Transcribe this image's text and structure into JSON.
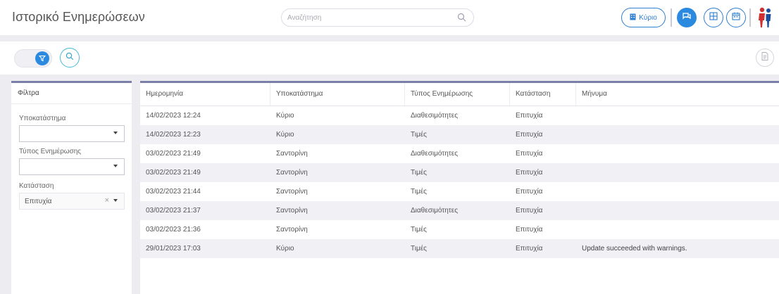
{
  "header": {
    "title": "Ιστορικό Ενημερώσεων",
    "search_placeholder": "Αναζήτηση",
    "branch_button": "Κύριο",
    "colors": {
      "accent": "#2b8ae0",
      "toolbar_border": "#7b7fa8"
    },
    "icons": [
      "search-icon",
      "building-icon",
      "chat-icon",
      "grid-icon",
      "calendar-icon",
      "logo-icon"
    ]
  },
  "toolbar": {
    "icons": [
      "filter-icon",
      "search-icon",
      "document-icon"
    ]
  },
  "filters": {
    "title": "Φίλτρα",
    "branch_label": "Υποκατάστημα",
    "branch_value": "",
    "update_type_label": "Τύπος Ενημέρωσης",
    "update_type_value": "",
    "status_label": "Κατάσταση",
    "status_value": "Επιτυχία"
  },
  "table": {
    "columns": [
      "Ημερομηνία",
      "Υποκατάστημα",
      "Τύπος Ενημέρωσης",
      "Κατάσταση",
      "Μήνυμα"
    ],
    "rows": [
      [
        "14/02/2023 12:24",
        "Κύριο",
        "Διαθεσιμότητες",
        "Επιτυχία",
        ""
      ],
      [
        "14/02/2023 12:23",
        "Κύριο",
        "Τιμές",
        "Επιτυχία",
        ""
      ],
      [
        "03/02/2023 21:49",
        "Σαντορίνη",
        "Διαθεσιμότητες",
        "Επιτυχία",
        ""
      ],
      [
        "03/02/2023 21:49",
        "Σαντορίνη",
        "Τιμές",
        "Επιτυχία",
        ""
      ],
      [
        "03/02/2023 21:44",
        "Σαντορίνη",
        "Τιμές",
        "Επιτυχία",
        ""
      ],
      [
        "03/02/2023 21:37",
        "Σαντορίνη",
        "Διαθεσιμότητες",
        "Επιτυχία",
        ""
      ],
      [
        "03/02/2023 21:36",
        "Σαντορίνη",
        "Τιμές",
        "Επιτυχία",
        ""
      ],
      [
        "29/01/2023 17:03",
        "Κύριο",
        "Τιμές",
        "Επιτυχία",
        "Update succeeded with warnings."
      ]
    ]
  }
}
